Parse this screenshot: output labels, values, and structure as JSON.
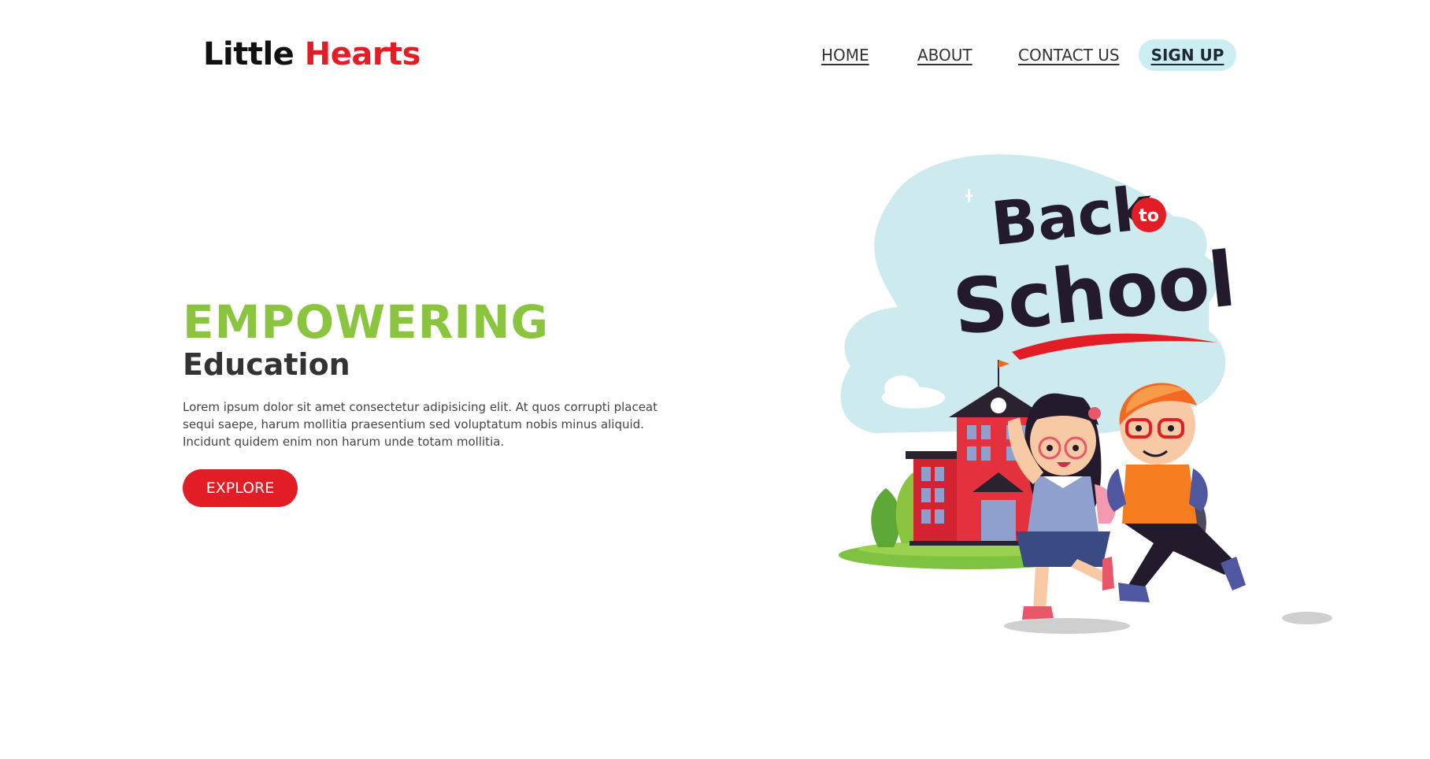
{
  "brand": {
    "part1": "Little",
    "part2": "Hearts"
  },
  "nav": {
    "home": "HOME",
    "about": "ABOUT",
    "contact": "CONTACT US",
    "signup": "SIGN UP"
  },
  "hero": {
    "title": "EMPOWERING",
    "subtitle": "Education",
    "description": "Lorem ipsum dolor sit amet consectetur adipisicing elit. At quos corrupti placeat sequi saepe, harum mollitia praesentium sed voluptatum nobis minus aliquid. Incidunt quidem enim non harum unde totam mollitia.",
    "cta": "EXPLORE"
  },
  "illustration": {
    "line1": "Back",
    "badge": "to",
    "line2": "School"
  },
  "colors": {
    "brand_red": "#e31d25",
    "green": "#8bc53f",
    "signup_bg": "#cdeef0",
    "blob": "#cdebee"
  }
}
